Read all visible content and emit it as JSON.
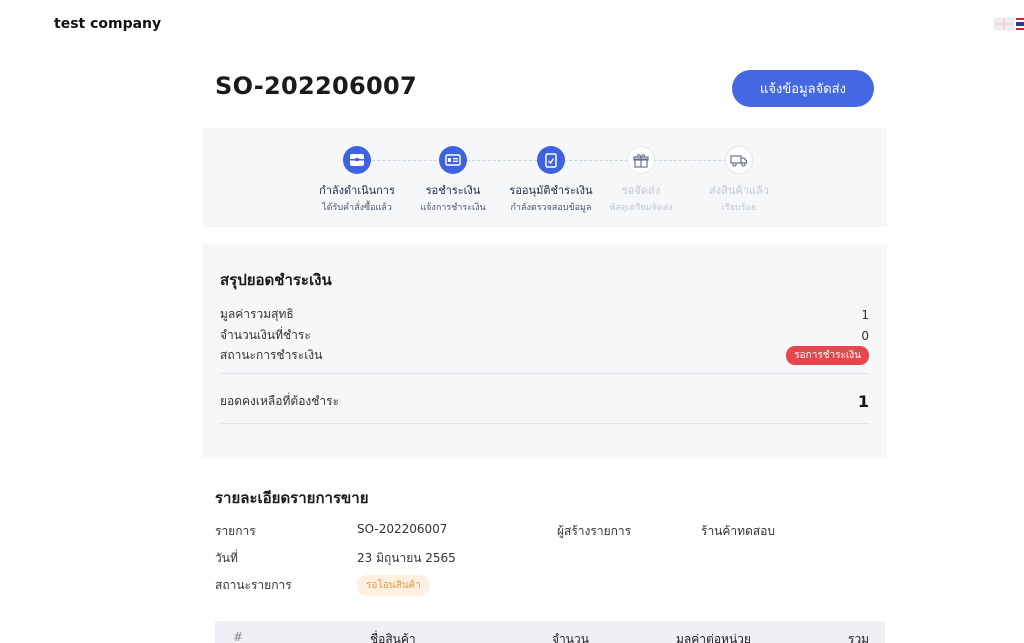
{
  "header": {
    "company": "test company"
  },
  "order": {
    "number": "SO-202206007",
    "notify_button": "แจ้งข้อมูลจัดส่ง"
  },
  "steps": [
    {
      "title": "กำลังดำเนินการ",
      "sub": "ได้รับคำสั่งซื้อแล้ว",
      "icon": "inbox-icon",
      "state": "active"
    },
    {
      "title": "รอชำระเงิน",
      "sub": "แจ้งการชำระเงิน",
      "icon": "payment-card-icon",
      "state": "active"
    },
    {
      "title": "รออนุมัติชำระเงิน",
      "sub": "กำลังตรวจสอบข้อมูล",
      "icon": "document-check-icon",
      "state": "active"
    },
    {
      "title": "รอจัดส่ง",
      "sub": "พัสดุเตรียมจัดส่ง",
      "icon": "gift-box-icon",
      "state": "pending"
    },
    {
      "title": "ส่งสินค้าแล้ว",
      "sub": "เรียบร้อย",
      "icon": "delivery-truck-icon",
      "state": "pending"
    }
  ],
  "summary": {
    "title": "สรุปยอดชำระเงิน",
    "net_label": "มูลค่ารวมสุทธิ",
    "net_value": "1",
    "paid_label": "จำนวนเงินที่ชำระ",
    "paid_value": "0",
    "status_label": "สถานะการชำระเงิน",
    "status_value": "รอการชำระเงิน",
    "balance_label": "ยอดคงเหลือที่ต้องชำระ",
    "balance_value": "1"
  },
  "details": {
    "title": "รายละเอียดรายการขาย",
    "item_label": "รายการ",
    "item_value": "SO-202206007",
    "creator_label": "ผู้สร้างรายการ",
    "creator_value": "ร้านค้าทดสอบ",
    "date_label": "วันที่",
    "date_value": "23 มิถุนายน 2565",
    "status_label": "สถานะรายการ",
    "status_value": "รอโอนสินค้า"
  },
  "table": {
    "headers": [
      "#",
      "ชื่อสินค้า",
      "จำนวน",
      "มูลค่าต่อหน่วย",
      "รวม"
    ]
  },
  "colors": {
    "primary": "#4467e3",
    "danger": "#e8464f",
    "warning": "#e89a46",
    "panel": "#f6f7f9"
  }
}
